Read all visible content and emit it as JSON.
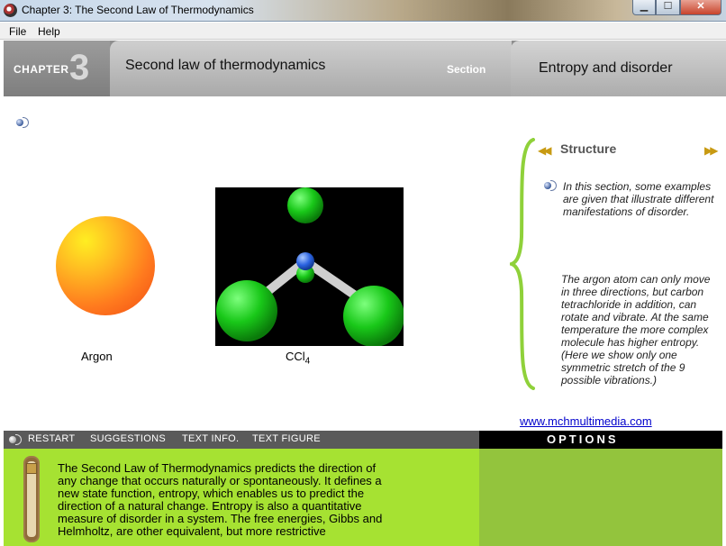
{
  "window": {
    "title": "Chapter 3: The Second Law of Thermodynamics",
    "min_label": "▁",
    "max_label": "☐",
    "close_label": "✕"
  },
  "menu": {
    "file": "File",
    "help": "Help"
  },
  "header": {
    "chapter_label": "CHAPTER",
    "chapter_number": "3",
    "chapter_title": "Second law of thermodynamics",
    "section_label": "Section",
    "section_title": "Entropy and disorder"
  },
  "molecules": {
    "argon_label": "Argon",
    "ccl4_label_main": "CCl",
    "ccl4_label_sub": "4"
  },
  "panel": {
    "title": "Structure",
    "prev_icon": "◀◀",
    "next_icon": "▶▶",
    "description": "In this section, some examples are given that illustrate different manifestations of disorder.",
    "explanation": "The argon atom can only move in three directions, but carbon tetrachloride in addition, can rotate and vibrate.  At the same temperature the more complex molecule has higher entropy. (Here we show only one symmetric stretch of the 9 possible vibrations.)",
    "link": "www.mchmultimedia.com"
  },
  "toolbar": {
    "restart": "RESTART",
    "suggestions": "SUGGESTIONS",
    "text_info": "TEXT INFO.",
    "text_figure": "TEXT FIGURE",
    "options": "OPTIONS"
  },
  "body_text": "The Second Law of Thermodynamics predicts the direction of any change that occurs naturally or spontaneously.  It defines a new state function, entropy, which enables us to predict the direction of a natural change. Entropy is also a quantitative measure of disorder in a system.  The free energies, Gibbs and Helmholtz, are other equivalent, but more restrictive",
  "colors": {
    "accent_green": "#a6e232",
    "header_gray": "#8f8f8f",
    "link_blue": "#0000cc"
  }
}
